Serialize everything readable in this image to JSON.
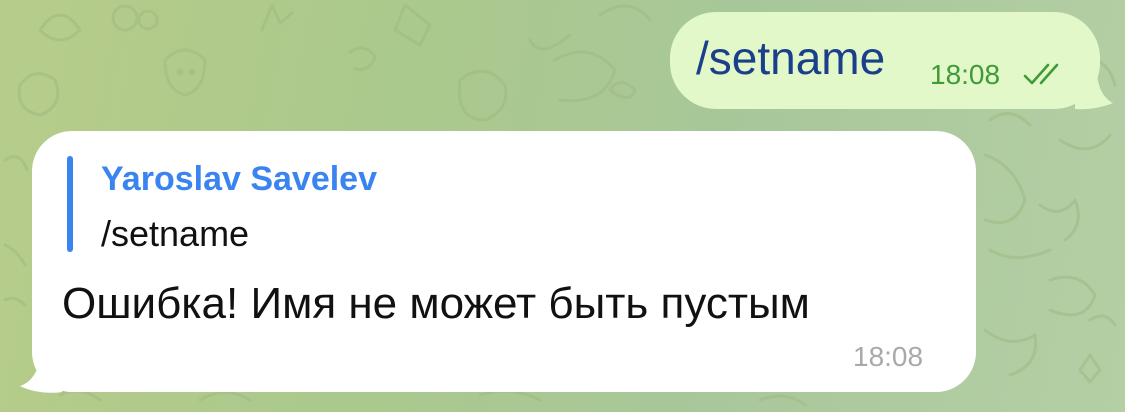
{
  "chat": {
    "background_colors": [
      "#b7cc8a",
      "#aac98c",
      "#a8c79a",
      "#b5cfa5"
    ]
  },
  "outgoing_message": {
    "text": "/setname",
    "time": "18:08",
    "status_icon": "double-check-icon",
    "bubble_color": "#e2f8c8",
    "text_color": "#1b3f8a",
    "time_color": "#3f9a37"
  },
  "incoming_message": {
    "reply": {
      "author": "Yaroslav Savelev",
      "text": "/setname",
      "accent_color": "#3a84f2"
    },
    "text": "Ошибка! Имя не может быть пустым",
    "time": "18:08",
    "bubble_color": "#ffffff",
    "time_color": "#a9a9a9"
  }
}
